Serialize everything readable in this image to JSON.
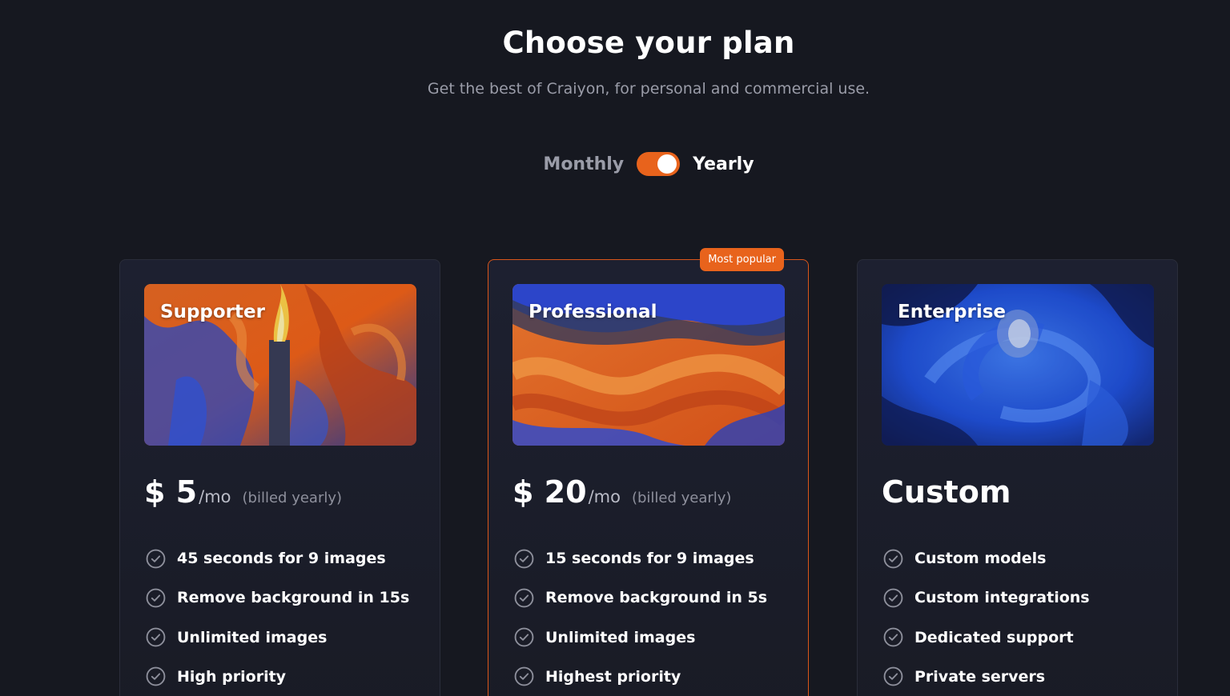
{
  "header": {
    "title": "Choose your plan",
    "subtitle": "Get the best of Craiyon, for personal and commercial use."
  },
  "billing_toggle": {
    "monthly_label": "Monthly",
    "yearly_label": "Yearly",
    "selected": "Yearly"
  },
  "plans": [
    {
      "name": "Supporter",
      "currency": "$",
      "amount": "5",
      "price_display": "$ 5",
      "unit": "/mo",
      "note": "(billed yearly)",
      "features": [
        "45 seconds for 9 images",
        "Remove background in 15s",
        "Unlimited images",
        "High priority"
      ]
    },
    {
      "name": "Professional",
      "badge": "Most popular",
      "currency": "$",
      "amount": "20",
      "price_display": "$ 20",
      "unit": "/mo",
      "note": "(billed yearly)",
      "features": [
        "15 seconds for 9 images",
        "Remove background in 5s",
        "Unlimited images",
        "Highest priority"
      ]
    },
    {
      "name": "Enterprise",
      "price_display": "Custom",
      "features": [
        "Custom models",
        "Custom integrations",
        "Dedicated support",
        "Private servers"
      ]
    }
  ],
  "colors": {
    "background": "#161820",
    "accent": "#e8631c",
    "card": "#1d2030",
    "muted_text": "#9a9ca8"
  }
}
